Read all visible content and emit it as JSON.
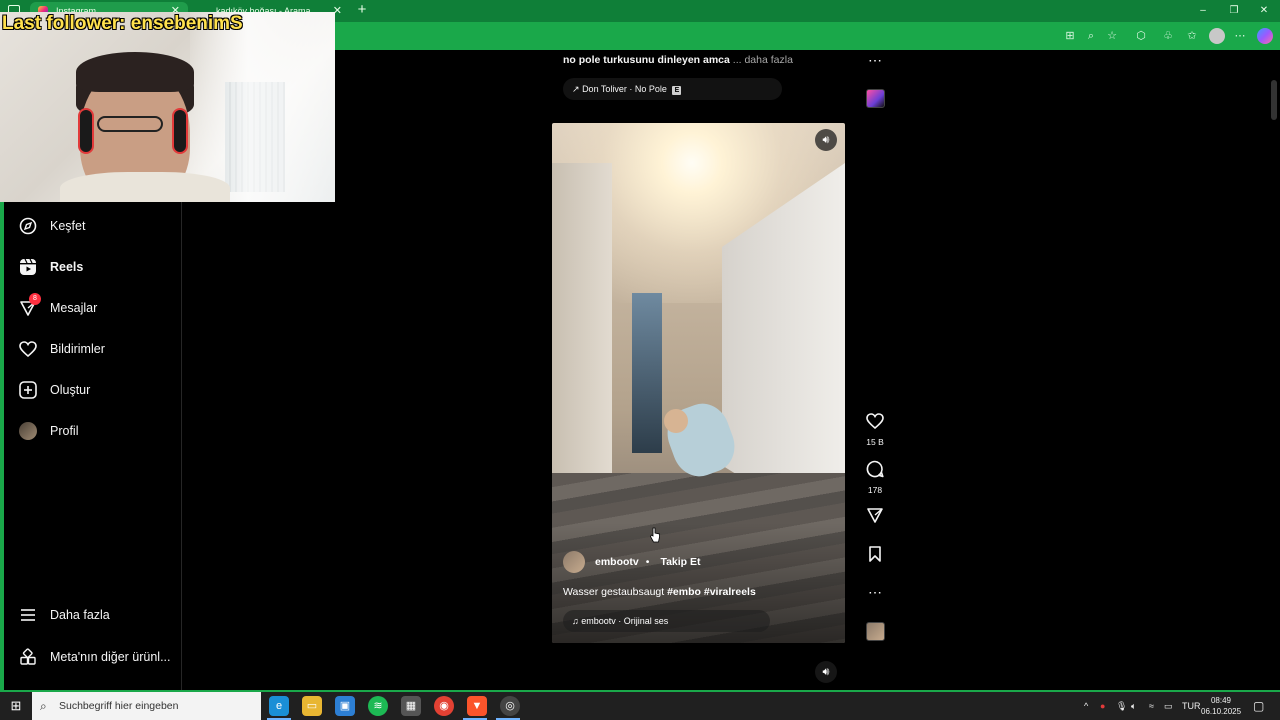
{
  "browser": {
    "tabs": [
      {
        "label": "Instagram",
        "active": true
      },
      {
        "label": "kadıköy boğası - Arama",
        "active": false
      }
    ],
    "new_tab": "+",
    "window_controls": {
      "minimize": "–",
      "maximize": "❐",
      "close": "✕"
    }
  },
  "overlay": {
    "follower_text": "Last follower: ensebenimS"
  },
  "sidebar": {
    "items": [
      {
        "label": "Keşfet",
        "icon": "compass-icon"
      },
      {
        "label": "Reels",
        "icon": "reels-icon",
        "active": true
      },
      {
        "label": "Mesajlar",
        "icon": "messenger-icon",
        "badge": "8"
      },
      {
        "label": "Bildirimler",
        "icon": "heart-icon"
      },
      {
        "label": "Oluştur",
        "icon": "plus-square-icon"
      },
      {
        "label": "Profil",
        "icon": "avatar"
      }
    ],
    "more_label": "Daha fazla",
    "meta_label": "Meta'nın diğer ürünl..."
  },
  "previous_reel": {
    "caption": "no pole turkusunu dinleyen amca",
    "more": "... daha fazla",
    "music": "Don Toliver · No Pole",
    "explicit": "E"
  },
  "reel": {
    "username": "embootv",
    "separator": "•",
    "follow_label": "Takip Et",
    "caption_text": "Wasser gestaubsaugt",
    "hashtags": "#embo #viralreels",
    "audio": "embootv · Orijinal ses",
    "likes": "15 B",
    "comments": "178"
  },
  "taskbar": {
    "search_placeholder": "Suchbegriff hier eingeben",
    "language": "TUR",
    "time": "08:49",
    "date": "06.10.2025"
  },
  "colors": {
    "browser_accent": "#1aa84a",
    "follower_text": "#ffe14d",
    "badge": "#ff3040"
  }
}
